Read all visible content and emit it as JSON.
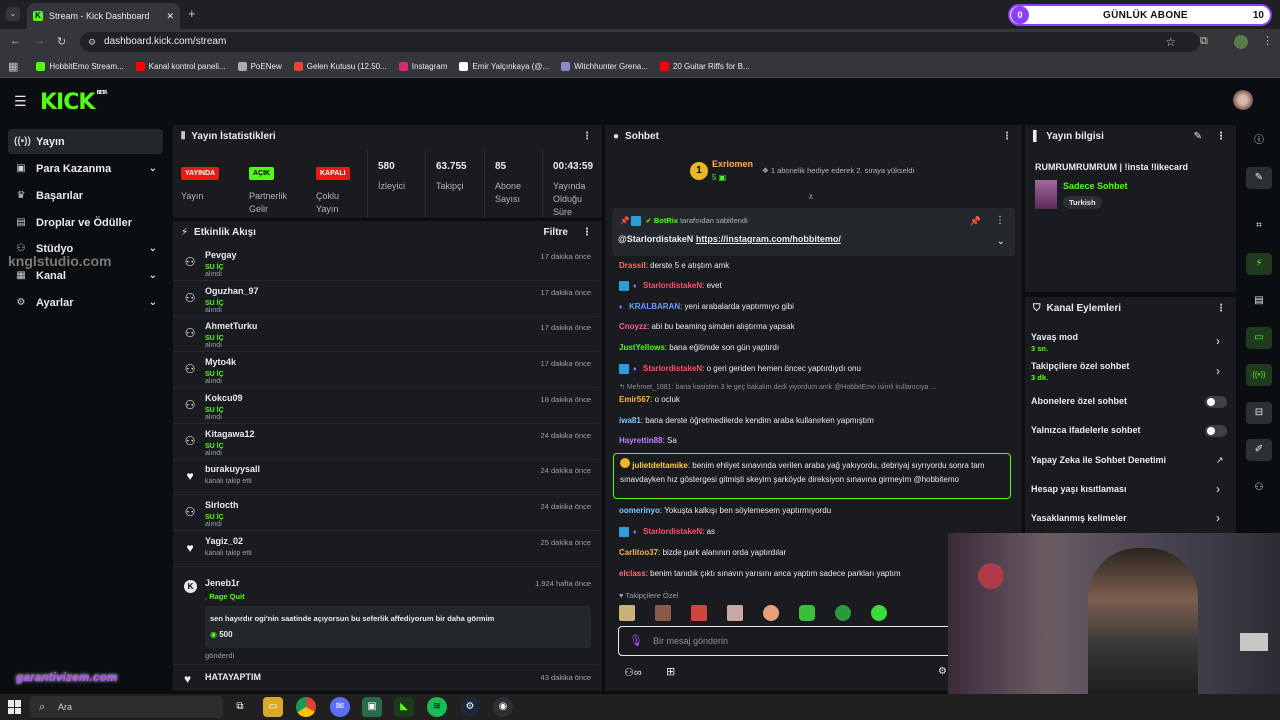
{
  "browser": {
    "tab_title": "Stream - Kick Dashboard",
    "url": "dashboard.kick.com/stream",
    "bookmarks": [
      {
        "label": "HobbitEmo Stream...",
        "color": "#53fc18"
      },
      {
        "label": "Kanal kontrol paneli...",
        "color": "#ff0000"
      },
      {
        "label": "PoENew",
        "color": "#aaaaaa"
      },
      {
        "label": "Gelen Kutusu (12.50...",
        "color": "#ea4335"
      },
      {
        "label": "Instagram",
        "color": "#d62976"
      },
      {
        "label": "Emir Yalçınkaya (@...",
        "color": "#ffffff"
      },
      {
        "label": "Witchhunter Grena...",
        "color": "#8888cc"
      },
      {
        "label": "20 Guitar Riffs for B...",
        "color": "#ff0000"
      }
    ]
  },
  "abone_widget": {
    "count": "0",
    "label": "GÜNLÜK ABONE",
    "target": "10"
  },
  "brand": {
    "logo": "KICK",
    "beta": "BETA"
  },
  "nav": [
    {
      "label": "Yayın",
      "icon": "broadcast-icon"
    },
    {
      "label": "Para Kazanma",
      "icon": "money-icon"
    },
    {
      "label": "Başarılar",
      "icon": "trophy-icon"
    },
    {
      "label": "Droplar ve Ödüller",
      "icon": "gift-icon"
    },
    {
      "label": "Stüdyo",
      "icon": "studio-icon"
    },
    {
      "label": "Kanal",
      "icon": "channel-icon"
    },
    {
      "label": "Ayarlar",
      "icon": "gear-icon"
    }
  ],
  "stats": {
    "title": "Yayın İstatistikleri",
    "badges": [
      {
        "value": "YAYINDA",
        "label": "Yayın",
        "bg": "#e91916",
        "fg": "#ffffff"
      },
      {
        "value": "AÇIK",
        "label": "Partnerlik Gelir",
        "bg": "#53fc18",
        "fg": "#000000"
      },
      {
        "value": "KAPALI",
        "label": "Çoklu Yayın",
        "bg": "#e91916",
        "fg": "#ffffff"
      }
    ],
    "numbers": [
      {
        "value": "580",
        "label": "İzleyici"
      },
      {
        "value": "63.755",
        "label": "Takipçi"
      },
      {
        "value": "85",
        "label": "Abone Sayısı"
      },
      {
        "value": "00:43:59",
        "label": "Yayında Olduğu Süre"
      }
    ]
  },
  "feed": {
    "title": "Etkinlik Akışı",
    "filter": "Filtre",
    "items": [
      {
        "name": "Pevgay",
        "action_hl": "SU İÇ",
        "action": "alındı",
        "time": "17 dakika önce",
        "icon": "redeem-icon"
      },
      {
        "name": "Oguzhan_97",
        "action_hl": "SU İÇ",
        "action": "alındı",
        "time": "17 dakika önce",
        "icon": "redeem-icon"
      },
      {
        "name": "AhmetTurku",
        "action_hl": "SU İÇ",
        "action": "alındı",
        "time": "17 dakika önce",
        "icon": "redeem-icon"
      },
      {
        "name": "Myto4k",
        "action_hl": "SU İÇ",
        "action": "alındı",
        "time": "17 dakika önce",
        "icon": "redeem-icon"
      },
      {
        "name": "Kokcu09",
        "action_hl": "SU İÇ",
        "action": "alındı",
        "time": "18 dakika önce",
        "icon": "redeem-icon"
      },
      {
        "name": "Kitagawa12",
        "action_hl": "SU İÇ",
        "action": "alındı",
        "time": "24 dakika önce",
        "icon": "redeem-icon"
      },
      {
        "name": "burakuyysall",
        "action_hl": "",
        "action": "kanalı takip etti",
        "time": "24 dakika önce",
        "icon": "heart-icon"
      },
      {
        "name": "Sirlocth",
        "action_hl": "SU İÇ",
        "action": "alındı",
        "time": "24 dakika önce",
        "icon": "redeem-icon"
      },
      {
        "name": "Yagiz_02",
        "action_hl": "",
        "action": "kanalı takip etti",
        "time": "25 dakika önce",
        "icon": "heart-icon"
      }
    ],
    "special": {
      "name": "Jeneb1r",
      "prefix": ",",
      "reward": "Rage Quit",
      "time": "1.924 hafta önce",
      "message": "sen hayırdır ogi'nin saatinde açıyorsun bu seferlik affediyorum bir daha görmim",
      "cost": "500",
      "footer": "gönderdi"
    },
    "last": {
      "name": "HATAYAPTIM",
      "time": "43 dakika önce"
    }
  },
  "chat": {
    "title": "Sohbet",
    "gift": {
      "rank": "1",
      "name": "Exriomen",
      "count": "5",
      "text": "1 abonelik hediye ederek 2. sıraya yükseldi"
    },
    "pinned": {
      "bot": "BotRix",
      "by": "tarafından sabitlendi",
      "user": "@StarlordistakeN",
      "link": "https://instagram.com/hobbitemo/"
    },
    "messages": [
      {
        "user": "Drassil",
        "color": "#ff6b6b",
        "text": ": derste 5 e atıştım amk",
        "badges": ""
      },
      {
        "user": "StarlordistakeN",
        "color": "#ff4d6d",
        "text": ": evet",
        "badges": "modvip"
      },
      {
        "user": "KRALBARAN",
        "color": "#6b9bff",
        "text": ": yeni arabalarda yaptırmıyo gibi",
        "badges": "vip"
      },
      {
        "user": "Cnoyzz",
        "color": "#ff5fa2",
        "text": ": abi bu beaming simden alıştırma yapsak",
        "badges": ""
      },
      {
        "user": "JustYellows",
        "color": "#53fc18",
        "text": ": bana eğitimde son gün yaptırdı",
        "badges": ""
      },
      {
        "user": "StarlordistakeN",
        "color": "#ff4d6d",
        "text": ": o geri geriden hemen öncec yaptırdıydı onu",
        "badges": "modvip"
      },
      {
        "user": "Emir567",
        "color": "#ffb347",
        "text": ": o ocluk",
        "badges": "",
        "reply": "Mehmet_1881: bana kasisten 3 le geç bakalım dedi yiyordum amk @HobbitEmo isimli kullanıcıya ..."
      },
      {
        "user": "iwa81",
        "color": "#7ec8ff",
        "text": ": bana derste öğretmedilerde kendim araba kullanırken yapmıştım",
        "badges": ""
      },
      {
        "user": "Hayrettin88",
        "color": "#c47dff",
        "text": ": Sa",
        "badges": ""
      }
    ],
    "highlight": {
      "user": "julietdeltamike",
      "color": "#ffd23f",
      "text": ": benim ehliyet sınavında verilen araba yağ yakıyordu, debriyaj sıyrıyordu sonra tam sınavdayken hız göstergesi gitmişti skeyim şarköyde direksiyon sınavına girmeyim @hobbitemo"
    },
    "messages2": [
      {
        "user": "oomerinyo",
        "color": "#7ec8ff",
        "text": ": Yokuşta kalkışı ben söylemesem yaptırmıyordu",
        "badges": ""
      },
      {
        "user": "StarlordistakeN",
        "color": "#ff4d6d",
        "text": ": as",
        "badges": "modvip"
      },
      {
        "user": "Carlitoo37",
        "color": "#ffb347",
        "text": ": bizde park alanının orda yaptırdılar",
        "badges": ""
      },
      {
        "user": "elclass",
        "color": "#ff6b6b",
        "text": ": benim tanıdık çıktı sınavın yarısını anca yaptım sadece parkları yaptım",
        "badges": ""
      }
    ],
    "followers_only": "Takipçilere Özel",
    "input_placeholder": "Bir mesaj gönderin"
  },
  "stream_info": {
    "title": "Yayın bilgisi",
    "stream_title": "RUMRUMRUMRUM | !insta !likecard",
    "category": "Sadece Sohbet",
    "tag": "Turkish"
  },
  "channel_actions": {
    "title": "Kanal Eylemleri",
    "items": [
      {
        "label": "Yavaş mod",
        "sub": "3 sn.",
        "control": "chevron"
      },
      {
        "label": "Takipçilere özel sohbet",
        "sub": "3 dk.",
        "control": "chevron"
      },
      {
        "label": "Abonelere özel sohbet",
        "sub": "",
        "control": "toggle"
      },
      {
        "label": "Yalnızca ifadelerle sohbet",
        "sub": "",
        "control": "toggle"
      },
      {
        "label": "Yapay Zeka ile Sohbet Denetimi",
        "sub": "",
        "control": "external"
      },
      {
        "label": "Hesap yaşı kısıtlaması",
        "sub": "",
        "control": "chevron"
      },
      {
        "label": "Yasaklanmış kelimeler",
        "sub": "",
        "control": "chevron"
      }
    ]
  },
  "watermarks": {
    "top": "knglstudio.com",
    "bottom": "garantivizem.com"
  },
  "taskbar": {
    "search": "Ara"
  }
}
